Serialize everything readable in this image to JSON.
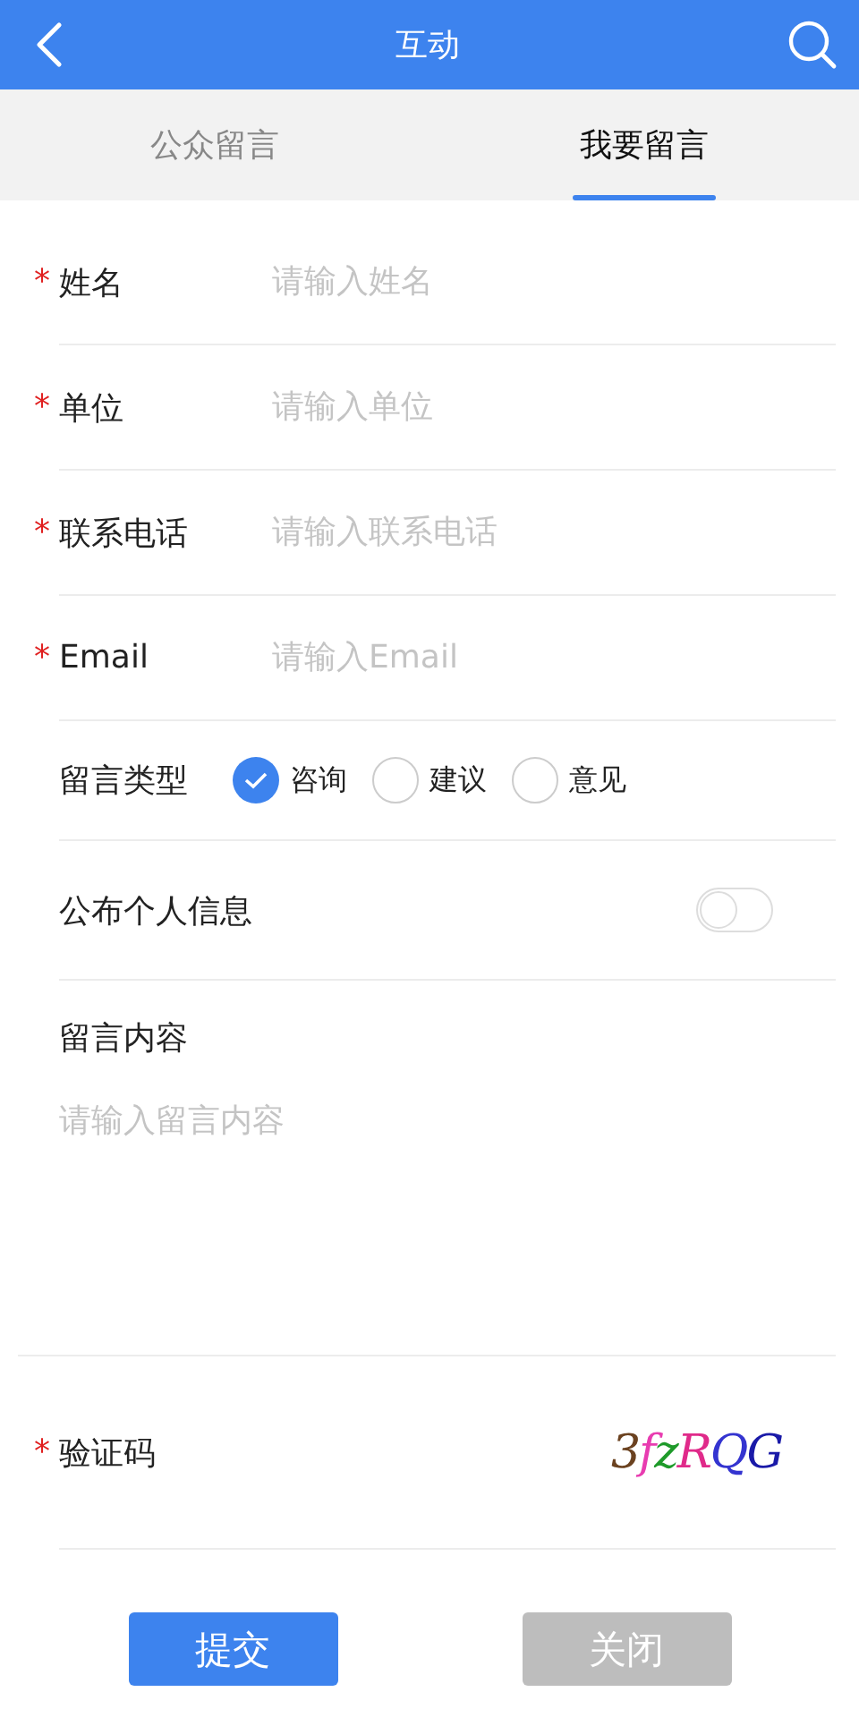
{
  "header": {
    "title": "互动"
  },
  "tabs": [
    {
      "label": "公众留言",
      "selected": false
    },
    {
      "label": "我要留言",
      "selected": true
    }
  ],
  "fields": [
    {
      "kind": "text",
      "mark": "*",
      "label": "姓名",
      "placeholder": "请输入姓名"
    },
    {
      "kind": "text",
      "mark": "*",
      "label": "单位",
      "placeholder": "请输入单位"
    },
    {
      "kind": "text",
      "mark": "*",
      "label": "联系电话",
      "placeholder": "请输入联系电话"
    },
    {
      "kind": "text",
      "mark": "*",
      "label": "Email",
      "placeholder": "请输入Email"
    },
    {
      "kind": "radio",
      "label": "留言类型",
      "options": [
        {
          "label": "咨询",
          "selected": true
        },
        {
          "label": "建议",
          "selected": false
        },
        {
          "label": "意见",
          "selected": false
        }
      ]
    },
    {
      "kind": "toggle",
      "label": "公布个人信息",
      "on": false
    },
    {
      "kind": "textarea",
      "label": "留言内容",
      "placeholder": "请输入留言内容"
    },
    {
      "kind": "captcha",
      "mark": "*",
      "label": "验证码",
      "captcha": "3fzRQG"
    }
  ],
  "buttons": [
    {
      "label": "提交",
      "kind": "primary"
    },
    {
      "label": "关闭",
      "kind": "secondary"
    }
  ]
}
